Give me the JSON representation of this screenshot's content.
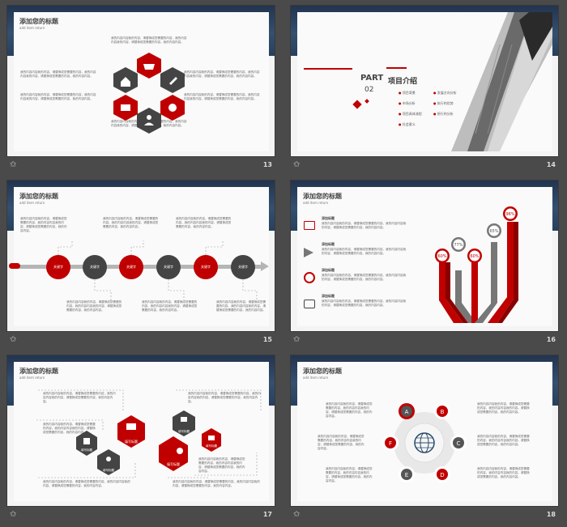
{
  "colors": {
    "accent": "#c00000",
    "dark": "#444444",
    "band": "#2b4563"
  },
  "footer": {
    "star_icon": "star-icon",
    "slide_numbers": [
      "13",
      "14",
      "15",
      "16",
      "17",
      "18"
    ]
  },
  "common": {
    "title": "添加您的标题",
    "subtitle": "add item return",
    "text_long": "我的内容内容我的内容，请替换成您需要的内容，我的内容内容我的内容，请替换成您需要的内容，我的内容内容。",
    "text_short": "请替换文字内容请替换文字内容",
    "item_title": "添加标题"
  },
  "s15": {
    "steps": [
      "关键字",
      "关键字",
      "关键字",
      "关键字",
      "关键字",
      "关键字"
    ]
  },
  "s14": {
    "part": "PART",
    "part_num": "02",
    "heading": "项目介绍",
    "items": [
      "项目背景",
      "市场分析",
      "项目具体流程",
      "社会意义",
      "发展方向分析",
      "执行的优势",
      "所行的分析"
    ]
  },
  "s16": {
    "items": [
      {
        "title": "添加标题",
        "icon": "monitor-icon"
      },
      {
        "title": "添加标题",
        "icon": "megaphone-icon"
      },
      {
        "title": "添加标题",
        "icon": "target-icon"
      },
      {
        "title": "添加标题",
        "icon": "camera-icon"
      }
    ],
    "pins": [
      {
        "label": "60%",
        "color": "#c00000"
      },
      {
        "label": "77%",
        "color": "#777777"
      },
      {
        "label": "60%",
        "color": "#c00000"
      },
      {
        "label": "65%",
        "color": "#777777"
      },
      {
        "label": "96%",
        "color": "#c00000"
      }
    ]
  },
  "s17": {
    "labels": [
      "填写标题",
      "填写标题",
      "填写标题",
      "填写标题",
      "填写标题",
      "填写标题"
    ]
  },
  "s18": {
    "letters": [
      "A",
      "B",
      "C",
      "D",
      "E",
      "F"
    ]
  }
}
